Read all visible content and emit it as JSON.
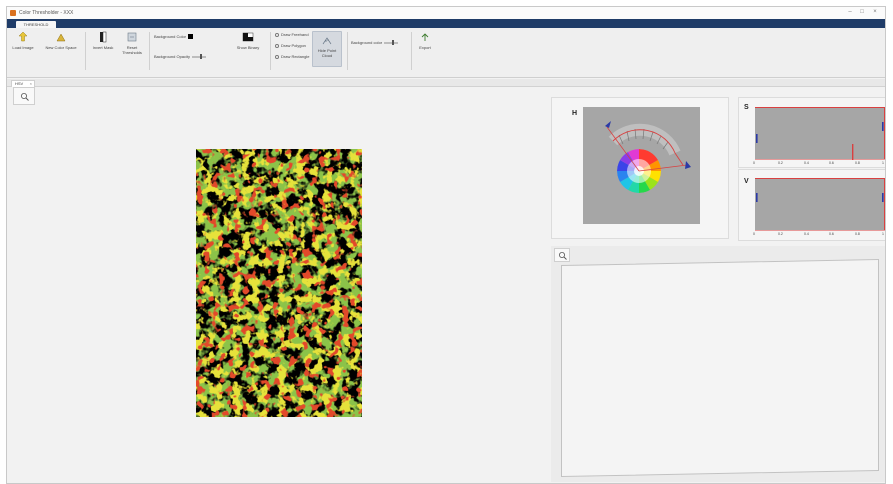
{
  "window": {
    "title": "Color Thresholder - XXX",
    "controls": [
      "–",
      "□",
      "×"
    ]
  },
  "ribbon": {
    "tab": "THRESHOLD",
    "tools": [
      {
        "label": "Load Image",
        "icon": "load-image-icon"
      },
      {
        "label": "New Color Space",
        "icon": "color-space-icon"
      },
      {
        "label": "Invert Mask",
        "icon": "invert-mask-icon"
      },
      {
        "label": "Reset Thresholds",
        "icon": "reset-icon"
      },
      {
        "label": "Show Binary",
        "icon": "binary-icon"
      },
      {
        "label": "Hide Point Cloud",
        "icon": "point-cloud-icon"
      },
      {
        "label": "Export",
        "icon": "export-icon"
      }
    ],
    "background_color_label": "Background Color",
    "background_opacity_label": "Background Opacity",
    "draw_options": [
      "Draw Freehand",
      "Draw Polygon",
      "Draw Rectangle"
    ],
    "point_cloud_bg_label": "Background color",
    "colors": {
      "accent": "#1f3c68",
      "background_swatch": "#000000"
    }
  },
  "doc_tab": {
    "label": "HSV",
    "close": "×"
  },
  "panels": {
    "h_label": "H",
    "s_label": "S",
    "v_label": "V",
    "s_ticks": [
      "0",
      "0.2",
      "0.4",
      "0.6",
      "0.8",
      "1"
    ],
    "v_ticks": [
      "0",
      "0.2",
      "0.4",
      "0.6",
      "0.8",
      "1"
    ]
  }
}
